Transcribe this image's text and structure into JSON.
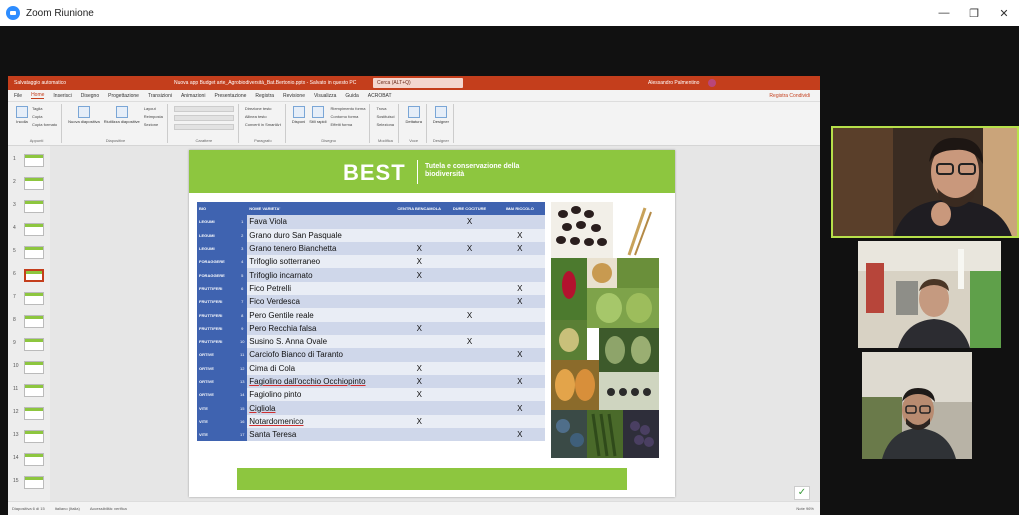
{
  "window": {
    "title": "Zoom Riunione",
    "minimize_glyph": "—",
    "maximize_glyph": "❐",
    "close_glyph": "✕"
  },
  "ppt": {
    "autosave": "Salvataggio automatico",
    "doc_title": "Nuova app Budget arte_Agrobiodiversità_Bat.Bertonio.pptx - Salvato in questo PC",
    "search": "Cerca (ALT+Q)",
    "user": "Alessandro Palmentino",
    "tabs": [
      "File",
      "Home",
      "Inserisci",
      "Disegno",
      "Progettazione",
      "Transizioni",
      "Animazioni",
      "Presentazione",
      "Registra",
      "Revisione",
      "Visualizza",
      "Guida",
      "ACROBAT"
    ],
    "active_tab": "Home",
    "tabs_right": "Registra  Condividi",
    "ribbon": {
      "groups": [
        {
          "label": "Appunti",
          "buttons": [
            "Incolla"
          ],
          "rows": [
            "Taglia",
            "Copia",
            "Copia formato"
          ]
        },
        {
          "label": "Diapositive",
          "buttons": [
            "Nuova diapositiva",
            "Riutilizza diapositive"
          ],
          "rows": [
            "Layout",
            "Reimposta",
            "Sezione"
          ]
        },
        {
          "label": "Carattere",
          "buttons": [],
          "rows": [
            "",
            "",
            ""
          ]
        },
        {
          "label": "Paragrafo",
          "buttons": [],
          "rows": [
            "Direzione testo",
            "Allinea testo",
            "Converti in SmartArt"
          ]
        },
        {
          "label": "Disegno",
          "buttons": [
            "Disponi",
            "Stili rapidi"
          ],
          "rows": [
            "Riempimento forma",
            "Contorno forma",
            "Effetti forma"
          ]
        },
        {
          "label": "Modifica",
          "buttons": [],
          "rows": [
            "Trova",
            "Sostituisci",
            "Seleziona"
          ]
        },
        {
          "label": "Voce",
          "buttons": [
            "Dettatura"
          ],
          "rows": []
        },
        {
          "label": "Designer",
          "buttons": [
            "Designer"
          ],
          "rows": []
        }
      ]
    },
    "thumb_numbers": [
      "1",
      "2",
      "3",
      "4",
      "5",
      "6",
      "7",
      "8",
      "9",
      "10",
      "11",
      "12",
      "13",
      "14",
      "15"
    ],
    "selected_slide": 6,
    "status_left": "Diapositiva 6 di 15",
    "status_lang": "Italiano (Italia)",
    "status_access": "Accessibilità: verifica",
    "status_right": "Note     96%"
  },
  "slide": {
    "brand": "BEST",
    "subtitle": "Tutela e conservazione della biodiversità",
    "headers": [
      "BIO",
      "",
      "NOME VARIETA'",
      "CENTRA BENCAMOLA",
      "DURE COCITURE",
      "IMAI RICCOLO"
    ],
    "rows": [
      {
        "grp": "LEGUMI",
        "num": "1",
        "name": "Fava Viola",
        "c1": "",
        "c2": "X",
        "c3": ""
      },
      {
        "grp": "LEGUMI",
        "num": "2",
        "name": "Grano duro San Pasquale",
        "c1": "",
        "c2": "",
        "c3": "X"
      },
      {
        "grp": "LEGUMI",
        "num": "3",
        "name": "Grano tenero Bianchetta",
        "c1": "X",
        "c2": "X",
        "c3": "X"
      },
      {
        "grp": "FORAGGERE",
        "num": "4",
        "name": "Trifoglio sotterraneo",
        "c1": "X",
        "c2": "",
        "c3": ""
      },
      {
        "grp": "FORAGGERE",
        "num": "5",
        "name": "Trifoglio incarnato",
        "c1": "X",
        "c2": "",
        "c3": ""
      },
      {
        "grp": "FRUTTIFERI",
        "num": "6",
        "name": "Fico Petrelli",
        "c1": "",
        "c2": "",
        "c3": "X"
      },
      {
        "grp": "FRUTTIFERI",
        "num": "7",
        "name": "Fico Verdesca",
        "c1": "",
        "c2": "",
        "c3": "X"
      },
      {
        "grp": "FRUTTIFERI",
        "num": "8",
        "name": "Pero Gentile reale",
        "c1": "",
        "c2": "X",
        "c3": ""
      },
      {
        "grp": "FRUTTIFERI",
        "num": "9",
        "name": "Pero Recchia falsa",
        "c1": "X",
        "c2": "",
        "c3": ""
      },
      {
        "grp": "FRUTTIFERI",
        "num": "10",
        "name": "Susino S. Anna Ovale",
        "c1": "",
        "c2": "X",
        "c3": ""
      },
      {
        "grp": "ORTIVE",
        "num": "11",
        "name": "Carciofo Bianco di Taranto",
        "c1": "",
        "c2": "",
        "c3": "X"
      },
      {
        "grp": "ORTIVE",
        "num": "12",
        "name": "Cima di Cola",
        "c1": "X",
        "c2": "",
        "c3": ""
      },
      {
        "grp": "ORTIVE",
        "num": "13",
        "name": "Fagiolino dall'occhio Occhiopinto",
        "c1": "X",
        "c2": "",
        "c3": "X"
      },
      {
        "grp": "ORTIVE",
        "num": "14",
        "name": "Fagiolino pinto",
        "c1": "X",
        "c2": "",
        "c3": ""
      },
      {
        "grp": "VITE",
        "num": "15",
        "name": "Cigliola",
        "c1": "",
        "c2": "",
        "c3": "X"
      },
      {
        "grp": "VITE",
        "num": "16",
        "name": "Notardomenico",
        "c1": "X",
        "c2": "",
        "c3": ""
      },
      {
        "grp": "VITE",
        "num": "17",
        "name": "Santa Teresa",
        "c1": "",
        "c2": "",
        "c3": "X"
      }
    ]
  },
  "colors": {
    "ppt_accent": "#c43e1c",
    "slide_green": "#8dc63f",
    "table_blue": "#3f63b0",
    "active_speaker": "#b7e04a"
  },
  "icons": {
    "check": "✓"
  }
}
